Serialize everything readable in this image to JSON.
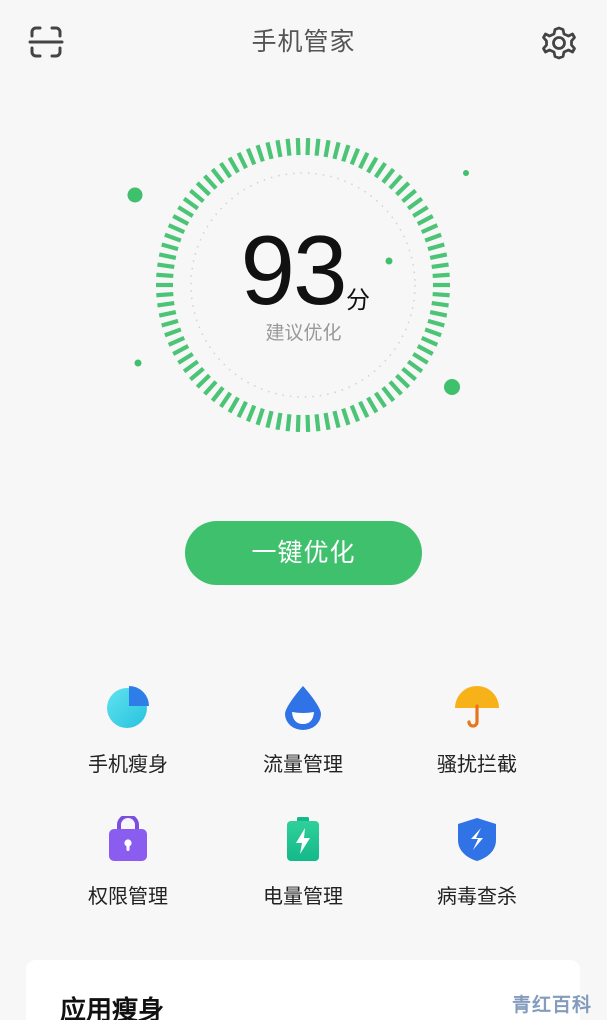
{
  "header": {
    "title": "手机管家",
    "scan_icon": "scan-icon",
    "settings_icon": "gear-icon"
  },
  "score": {
    "value": "93",
    "unit": "分",
    "hint": "建议优化"
  },
  "optimize_button": {
    "label": "一键优化"
  },
  "tools": [
    {
      "label": "手机瘦身",
      "icon": "pie-chart-icon"
    },
    {
      "label": "流量管理",
      "icon": "water-drop-icon"
    },
    {
      "label": "骚扰拦截",
      "icon": "umbrella-icon"
    },
    {
      "label": "权限管理",
      "icon": "lock-bag-icon"
    },
    {
      "label": "电量管理",
      "icon": "battery-icon"
    },
    {
      "label": "病毒查杀",
      "icon": "shield-icon"
    }
  ],
  "card": {
    "title": "应用瘦身"
  },
  "watermark": "青红百科",
  "colors": {
    "accent": "#3fc06c",
    "ring": "#4cc476"
  }
}
